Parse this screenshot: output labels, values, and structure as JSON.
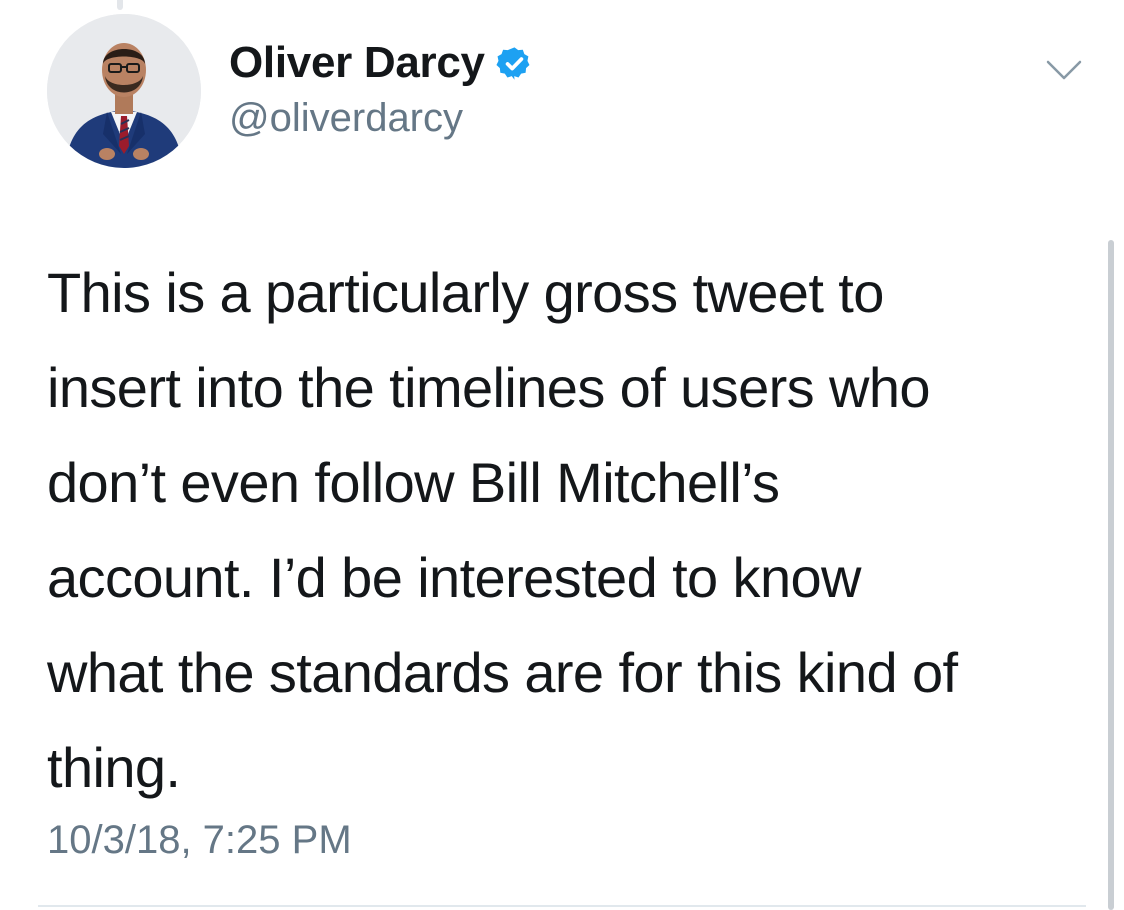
{
  "tweet": {
    "author": {
      "name": "Oliver Darcy",
      "handle": "@oliverdarcy",
      "verified": true,
      "avatar_icon": "profile-photo"
    },
    "text": "This is a particularly gross tweet to\ninsert into the timelines of users who\ndon’t even follow Bill Mitchell’s\naccount. I’d be interested to know\nwhat the standards are for this kind of\nthing.",
    "timestamp": "10/3/18, 7:25 PM",
    "menu_icon": "chevron-down-icon"
  },
  "colors": {
    "text_primary": "#14171a",
    "text_secondary": "#657786",
    "verified_blue": "#1da1f2",
    "divider": "#e1e8ed"
  }
}
